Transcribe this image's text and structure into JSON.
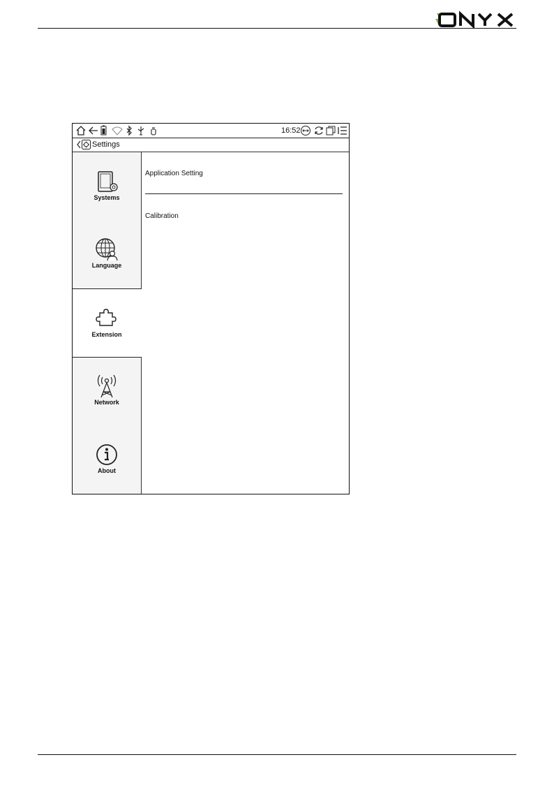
{
  "brand": {
    "logo_text": "ONYX",
    "accent": "#7bc043"
  },
  "status_bar": {
    "icons": [
      "home-icon",
      "back-arrow-icon",
      "battery-icon",
      "wifi-icon",
      "bluetooth-icon",
      "usb-icon",
      "touch-icon",
      "refresh-mode-icon",
      "sync-icon",
      "multiwindow-icon",
      "menu-icon"
    ],
    "time": "16:52"
  },
  "title_bar": {
    "title": "Settings"
  },
  "sidebar": {
    "items": [
      {
        "label": "Systems",
        "icon": "systems-icon",
        "active": false
      },
      {
        "label": "Language",
        "icon": "globe-icon",
        "active": false
      },
      {
        "label": "Extension",
        "icon": "puzzle-icon",
        "active": true
      },
      {
        "label": "Network",
        "icon": "antenna-icon",
        "active": false
      },
      {
        "label": "About",
        "icon": "info-icon",
        "active": false
      }
    ]
  },
  "content": {
    "items": [
      {
        "label": "Application Setting"
      },
      {
        "label": "Calibration"
      }
    ]
  }
}
